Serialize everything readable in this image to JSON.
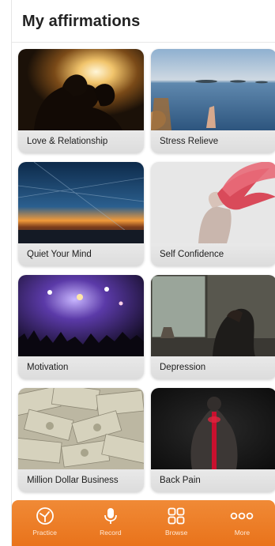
{
  "header": {
    "title": "My affirmations"
  },
  "cards": [
    {
      "label": "Love & Relationship"
    },
    {
      "label": "Stress Relieve"
    },
    {
      "label": "Quiet Your  Mind"
    },
    {
      "label": "Self Confidence"
    },
    {
      "label": "Motivation"
    },
    {
      "label": "Depression"
    },
    {
      "label": "Million Dollar Business"
    },
    {
      "label": "Back Pain"
    }
  ],
  "tabbar": {
    "items": [
      {
        "label": "Practice",
        "icon": "practice-icon"
      },
      {
        "label": "Record",
        "icon": "microphone-icon"
      },
      {
        "label": "Browse",
        "icon": "grid-icon"
      },
      {
        "label": "More",
        "icon": "more-dots-icon"
      }
    ]
  },
  "colors": {
    "accent": "#ee7f2a",
    "caption_bg": "#e3e3e3",
    "title": "#222222"
  }
}
